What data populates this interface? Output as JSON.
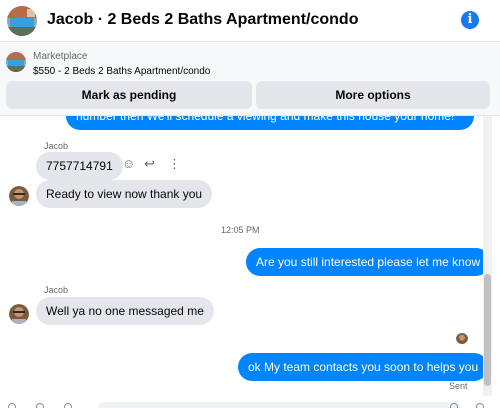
{
  "header": {
    "title": "Jacob · 2 Beds 2 Baths Apartment/condo",
    "info_icon": "info-icon",
    "info_glyph": "i"
  },
  "listing": {
    "source": "Marketplace",
    "item": "$550 - 2 Beds 2 Baths Apartment/condo",
    "pending_label": "Mark as pending",
    "more_label": "More options"
  },
  "messages": {
    "partial_out": "number then We'll schedule a viewing and make this house your home!",
    "sender1": "Jacob",
    "phone": "7757714791",
    "ready": "Ready to view now thank you",
    "time": "12:05 PM",
    "interested": "Are you still interested please let me know",
    "sender2": "Jacob",
    "noone": "Well ya no one messaged me",
    "team": "ok My team contacts you soon to helps you",
    "status": "Sent"
  },
  "icons": {
    "emoji": "☺",
    "reply": "↩",
    "more": "⋮"
  },
  "colors": {
    "accent": "#0084ff",
    "bubble_in": "#e4e6eb",
    "info": "#1877f2"
  }
}
